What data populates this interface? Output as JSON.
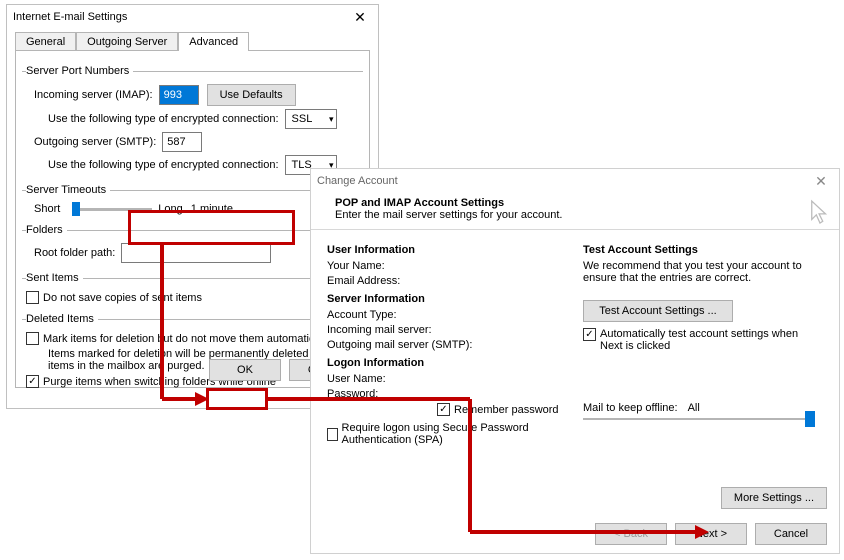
{
  "dlg1": {
    "title": "Internet E-mail Settings",
    "tabs": {
      "general": "General",
      "outgoing": "Outgoing Server",
      "advanced": "Advanced"
    },
    "group_ports": "Server Port Numbers",
    "incoming_label": "Incoming server (IMAP):",
    "incoming_value": "993",
    "use_defaults": "Use Defaults",
    "enc_label": "Use the following type of encrypted connection:",
    "enc_incoming": "SSL",
    "outgoing_label": "Outgoing server (SMTP):",
    "outgoing_value": "587",
    "enc_outgoing": "TLS",
    "group_timeouts": "Server Timeouts",
    "short": "Short",
    "long": "Long",
    "timeout_value": "1 minute",
    "group_folders": "Folders",
    "root_label": "Root folder path:",
    "root_value": "",
    "group_sent": "Sent Items",
    "sent_chk": "Do not save copies of sent items",
    "group_deleted": "Deleted Items",
    "del_chk1": "Mark items for deletion but do not move them automatically",
    "del_sub": "Items marked for deletion will be permanently deleted when the items in the mailbox are purged.",
    "del_chk2": "Purge items when switching folders while online",
    "ok": "OK",
    "cancel": "Cancel"
  },
  "dlg2": {
    "title": "Change Account",
    "heading": "POP and IMAP Account Settings",
    "sub": "Enter the mail server settings for your account.",
    "sect_user": "User Information",
    "your_name": "Your Name:",
    "email": "Email Address:",
    "sect_server": "Server Information",
    "acct_type": "Account Type:",
    "incoming_srv": "Incoming mail server:",
    "outgoing_srv": "Outgoing mail server (SMTP):",
    "sect_logon": "Logon Information",
    "user_name": "User Name:",
    "password": "Password:",
    "remember": "Remember password",
    "spa": "Require logon using Secure Password Authentication (SPA)",
    "sect_test": "Test Account Settings",
    "test_note": "We recommend that you test your account to ensure that the entries are correct.",
    "test_btn": "Test Account Settings ...",
    "auto_test": "Automatically test account settings when Next is clicked",
    "mail_keep": "Mail to keep offline:",
    "mail_keep_val": "All",
    "more": "More Settings ...",
    "back": "< Back",
    "next": "Next >",
    "cancel": "Cancel"
  }
}
